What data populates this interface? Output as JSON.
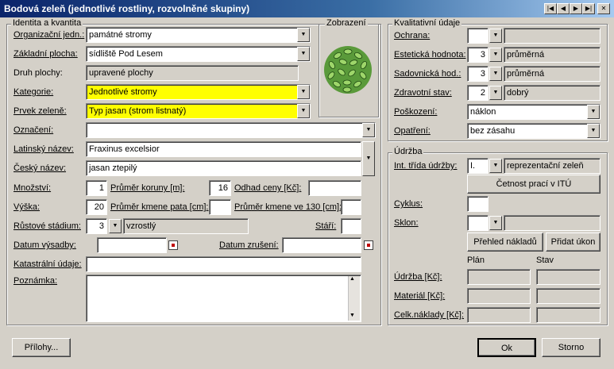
{
  "window": {
    "title": "Bodová zeleň (jednotlivé rostliny, rozvolněné skupiny)",
    "nav": [
      "|◀",
      "◀",
      "▶",
      "▶|",
      "✕"
    ]
  },
  "identita": {
    "group_title": "Identita a kvantita",
    "org_label": "Organizační jedn.:",
    "org_value": "památné stromy",
    "zakl_label": "Základní plocha:",
    "zakl_value": "sídliště Pod Lesem",
    "druh_label": "Druh plochy:",
    "druh_value": "upravené plochy",
    "kat_label": "Kategorie:",
    "kat_value": "Jednotlivé stromy",
    "prvek_label": "Prvek zeleně:",
    "prvek_value": "Typ jasan (strom listnatý)",
    "oznaceni_label": "Označení:",
    "oznaceni_value": "",
    "latin_label": "Latinský název:",
    "latin_value": "Fraxinus excelsior",
    "cesky_label": "Český název:",
    "cesky_value": "jasan ztepilý",
    "mnozstvi_label": "Množství:",
    "mnozstvi_value": "1",
    "koruna_label": "Průměr koruny [m]:",
    "koruna_value": "16",
    "odhad_label": "Odhad ceny [Kč]:",
    "odhad_value": "",
    "vyska_label": "Výška:",
    "vyska_value": "20",
    "pata_label": "Průměr kmene pata [cm]:",
    "pata_value": "",
    "kmen130_label": "Průměr kmene ve 130 [cm]:",
    "kmen130_value": "",
    "stadium_label": "Růstové stádium:",
    "stadium_num": "3",
    "stadium_text": "vzrostlý",
    "stari_label": "Stáří:",
    "stari_value": "",
    "vysadba_label": "Datum výsadby:",
    "vysadba_value": "",
    "zruseni_label": "Datum zrušení:",
    "zruseni_value": "",
    "katastr_label": "Katastrální údaje:",
    "katastr_value": "",
    "poznamka_label": "Poznámka:",
    "poznamka_value": ""
  },
  "zobrazeni": {
    "title": "Zobrazení",
    "icon": "tree-crown-icon"
  },
  "kvalita": {
    "group_title": "Kvalitativní údaje",
    "ochrana_label": "Ochrana:",
    "ochrana_num": "",
    "ochrana_text": "",
    "esteticka_label": "Estetická hodnota:",
    "esteticka_num": "3",
    "esteticka_text": "průměrná",
    "sadovnicka_label": "Sadovnická hod.:",
    "sadovnicka_num": "3",
    "sadovnicka_text": "průměrná",
    "zdravotni_label": "Zdravotní stav:",
    "zdravotni_num": "2",
    "zdravotni_text": "dobrý",
    "poskozeni_label": "Poškození:",
    "poskozeni_value": "náklon",
    "opatreni_label": "Opatření:",
    "opatreni_value": "bez zásahu"
  },
  "udrzba": {
    "group_title": "Údržba",
    "trida_label": "Int. třída údržby:",
    "trida_num": "I.",
    "trida_text": "reprezentační zeleň",
    "cetnost_button": "Četnost prací v ITÚ",
    "cyklus_label": "Cyklus:",
    "cyklus_value": "",
    "sklon_label": "Sklon:",
    "sklon_num": "",
    "sklon_text": "",
    "prehled_button": "Přehled nákladů",
    "pridat_button": "Přidat úkon",
    "plan_header": "Plán",
    "stav_header": "Stav",
    "udrzba_label": "Údržba [Kč]:",
    "material_label": "Materiál [Kč]:",
    "celk_label": "Celk.náklady [Kč]:"
  },
  "footer": {
    "prilohy_button": "Přílohy...",
    "ok_button": "Ok",
    "storno_button": "Storno"
  }
}
